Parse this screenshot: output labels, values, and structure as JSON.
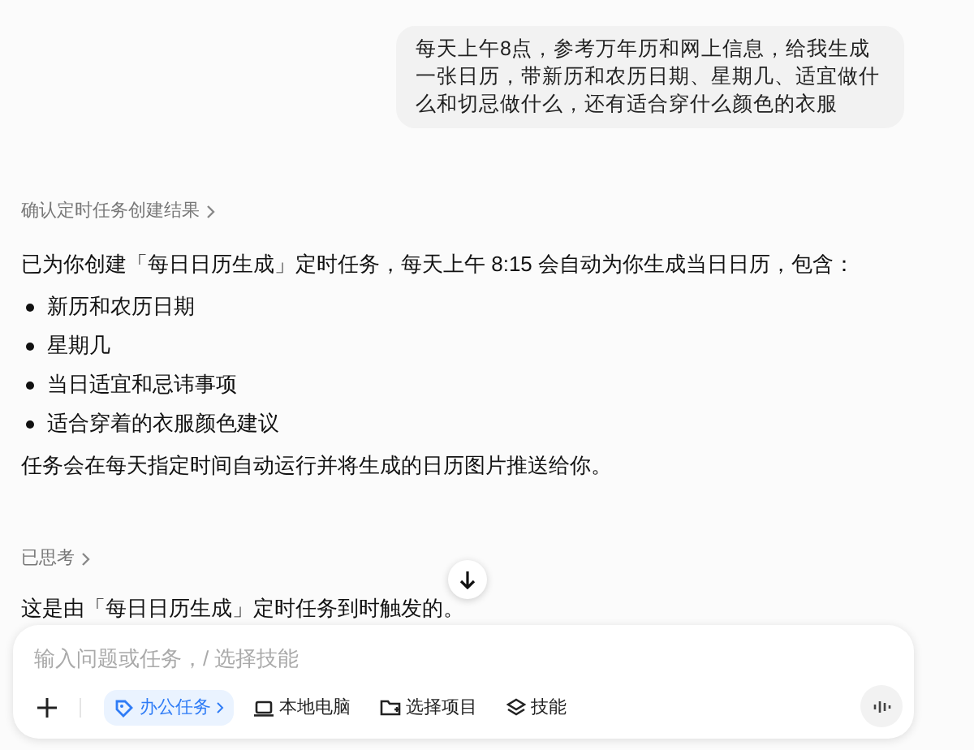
{
  "user_message": "每天上午8点，参考万年历和网上信息，给我生成一张日历，带新历和农历日期、星期几、适宜做什么和切忌做什么，还有适合穿什么颜色的衣服",
  "confirm_link": "确认定时任务创建结果",
  "reply": {
    "intro": "已为你创建「每日日历生成」定时任务，每天上午 8:15 会自动为你生成当日日历，包含：",
    "bullets": [
      "新历和农历日期",
      "星期几",
      "当日适宜和忌讳事项",
      "适合穿着的衣服颜色建议"
    ],
    "outro": "任务会在每天指定时间自动运行并将生成的日历图片推送给你。"
  },
  "thinking_link": "已思考",
  "trigger_message": "这是由「每日日历生成」定时任务到时触发的。",
  "composer": {
    "placeholder": "输入问题或任务，/ 选择技能",
    "chips": [
      {
        "kind": "office",
        "label": "办公任务",
        "selected": true
      },
      {
        "kind": "computer",
        "label": "本地电脑",
        "selected": false
      },
      {
        "kind": "folder",
        "label": "选择项目",
        "selected": false
      },
      {
        "kind": "skills",
        "label": "技能",
        "selected": false
      }
    ]
  }
}
